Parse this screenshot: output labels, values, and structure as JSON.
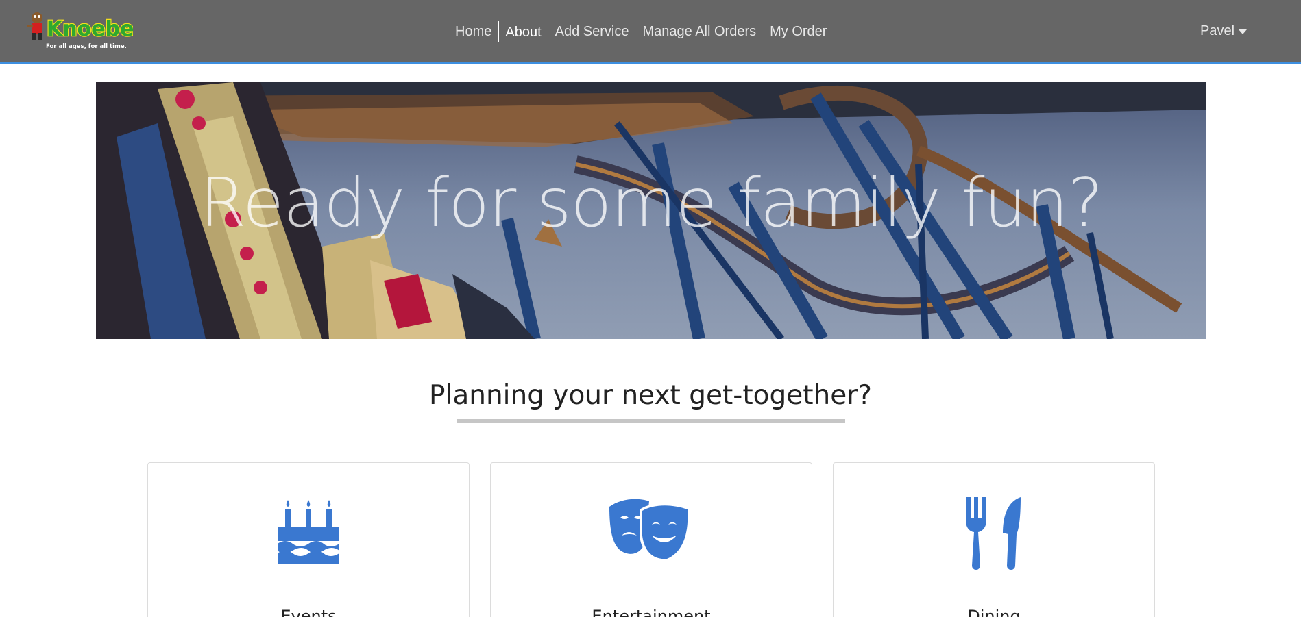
{
  "brand": {
    "name": "Knoebels",
    "tagline": "For all ages, for all time."
  },
  "nav": {
    "items": [
      {
        "label": "Home",
        "active": false
      },
      {
        "label": "About",
        "active": true
      },
      {
        "label": "Add Service",
        "active": false
      },
      {
        "label": "Manage All Orders",
        "active": false
      },
      {
        "label": "My Order",
        "active": false
      }
    ],
    "user": "Pavel"
  },
  "hero": {
    "title": "Ready for some family fun?"
  },
  "section": {
    "title": "Planning your next get-together?"
  },
  "cards": [
    {
      "label": "Events",
      "icon": "birthday-cake-icon"
    },
    {
      "label": "Entertainment",
      "icon": "theater-masks-icon"
    },
    {
      "label": "Dining",
      "icon": "utensils-icon"
    }
  ],
  "colors": {
    "navbar": "#666666",
    "navbar_border": "#3d8fe0",
    "icon_blue": "#3a78d0",
    "brand_green": "#2fa82f",
    "brand_yellow": "#f4e01c"
  }
}
